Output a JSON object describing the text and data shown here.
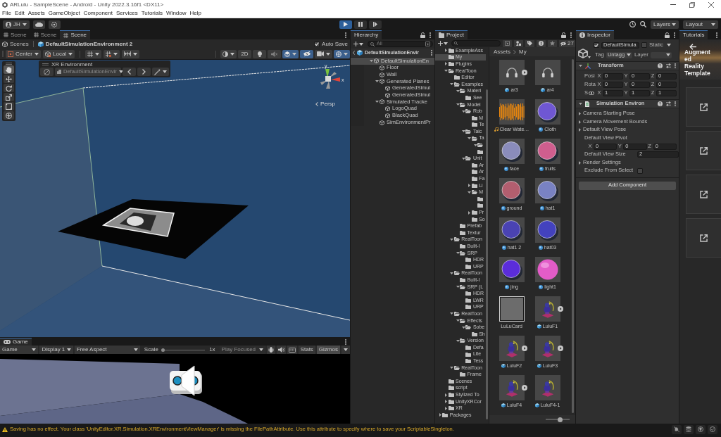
{
  "window": {
    "title": "ARLulu - SampleScene - Android - Unity 2022.3.16f1 <DX11>"
  },
  "menu": [
    "File",
    "Edit",
    "Assets",
    "GameObject",
    "Component",
    "Services",
    "Tutorials",
    "Window",
    "Help"
  ],
  "toolbar": {
    "account": "JH",
    "play_controls": [
      {
        "kind": "play",
        "on": true
      },
      {
        "kind": "pause",
        "on": false
      },
      {
        "kind": "step",
        "on": false
      }
    ],
    "layers": "Layers",
    "layout": "Layout"
  },
  "scene": {
    "tabs": [
      {
        "label": "Scene",
        "selected": false
      },
      {
        "label": "Scene",
        "selected": false
      },
      {
        "label": "Scene",
        "selected": true
      }
    ],
    "breadcrumb": {
      "root": "Scenes",
      "scene": "DefaultSimulationEnvironment 2"
    },
    "auto_save": {
      "label": "Auto Save",
      "checked": true
    },
    "pivot": "Center",
    "space": "Local",
    "mode_2d": "2D",
    "view_toggles": [
      {
        "kind": "lighting",
        "on": false
      },
      {
        "kind": "audio",
        "on": false
      },
      {
        "kind": "effects",
        "on": true
      },
      {
        "kind": "visibility",
        "on": true
      },
      {
        "kind": "camera",
        "on": false
      },
      {
        "kind": "gizmos",
        "on": true
      }
    ],
    "tools": [
      {
        "kind": "hand",
        "selected": true
      },
      {
        "kind": "move",
        "selected": false
      },
      {
        "kind": "rotate",
        "selected": false
      },
      {
        "kind": "scale",
        "selected": false
      },
      {
        "kind": "rect",
        "selected": false
      },
      {
        "kind": "transform",
        "selected": false
      }
    ],
    "xr_overlay": {
      "title": "XR Environment",
      "environment": "DefaultSimulationEnvir"
    },
    "gizmo": {
      "y_label": "y",
      "x_label": "x",
      "projection": "Persp"
    }
  },
  "game": {
    "tab": "Game",
    "view_mode": "Game",
    "display": "Display 1",
    "aspect": "Free Aspect",
    "scale": {
      "label": "Scale",
      "level": 0,
      "reading": "1x"
    },
    "play_mode": {
      "label": "Play Focused",
      "disabled": true
    },
    "stats": {
      "label": "Stats",
      "on": false
    },
    "gizmos": {
      "label": "Gizmos",
      "on": true
    }
  },
  "hierarchy": {
    "title": "Hierarchy",
    "search_placeholder": "All",
    "scene": "DefaultSimulationEnvir",
    "items": [
      {
        "label": "DefaultSimulationEn",
        "selected": true,
        "expanded": true,
        "children": [
          {
            "label": "Floor",
            "selected": false
          },
          {
            "label": "Wall",
            "selected": false
          },
          {
            "label": "Generated Planes",
            "selected": false,
            "expanded": true,
            "children": [
              {
                "label": "GeneratedSimul",
                "selected": false
              },
              {
                "label": "GeneratedSimul",
                "selected": false
              }
            ]
          },
          {
            "label": "Simulated Tracke",
            "selected": false,
            "expanded": true,
            "children": [
              {
                "label": "LogoQuad",
                "selected": false
              },
              {
                "label": "BlackQuad",
                "selected": false
              }
            ]
          },
          {
            "label": "SimEnvironmentPr",
            "selected": false
          }
        ]
      }
    ]
  },
  "project": {
    "title": "Project",
    "hidden_count": "27",
    "tree": [
      {
        "label": "ExampleAss",
        "selected": false,
        "expanded": false
      },
      {
        "label": "My",
        "selected": true
      },
      {
        "label": "Plugins",
        "selected": false,
        "expanded": false
      },
      {
        "label": "RealToon",
        "selected": false,
        "expanded": true,
        "children": [
          {
            "label": "Editor",
            "selected": false
          },
          {
            "label": "Examples",
            "selected": false,
            "expanded": true,
            "children": [
              {
                "label": "Materi",
                "selected": false,
                "expanded": true,
                "children": [
                  {
                    "label": "See",
                    "selected": false
                  }
                ]
              },
              {
                "label": "Model",
                "selected": false,
                "expanded": true,
                "children": [
                  {
                    "label": "Rob",
                    "selected": false,
                    "expanded": true,
                    "children": [
                      {
                        "label": "M",
                        "selected": false
                      },
                      {
                        "label": "Te",
                        "selected": false
                      }
                    ]
                  },
                  {
                    "label": "Taic",
                    "selected": false,
                    "expanded": true,
                    "children": [
                      {
                        "label": "Ta",
                        "selected": false,
                        "expanded": true,
                        "children": [
                          {
                            "selected": false,
                            "expanded": true
                          },
                          {
                            "selected": false
                          }
                        ]
                      }
                    ]
                  },
                  {
                    "label": "Unit",
                    "selected": false,
                    "expanded": true,
                    "children": [
                      {
                        "label": "Ar",
                        "selected": false
                      },
                      {
                        "label": "Ar",
                        "selected": false
                      },
                      {
                        "label": "Fa",
                        "selected": false
                      },
                      {
                        "label": "Li",
                        "selected": false,
                        "expanded": false
                      },
                      {
                        "label": "M",
                        "selected": false,
                        "expanded": true,
                        "children": [
                          {
                            "selected": false
                          },
                          {
                            "selected": false
                          }
                        ]
                      },
                      {
                        "label": "Pr",
                        "selected": false,
                        "expanded": false
                      },
                      {
                        "label": "So",
                        "selected": false
                      }
                    ]
                  }
                ]
              },
              {
                "label": "Prefab",
                "selected": false
              },
              {
                "label": "Textur",
                "selected": false
              }
            ]
          },
          {
            "label": "RealToon",
            "selected": false,
            "expanded": true,
            "children": [
              {
                "label": "Built-I",
                "selected": false
              },
              {
                "label": "SRP",
                "selected": false,
                "expanded": true,
                "children": [
                  {
                    "label": "HDR",
                    "selected": false
                  },
                  {
                    "label": "URP",
                    "selected": false
                  }
                ]
              }
            ]
          },
          {
            "label": "RealToon",
            "selected": false,
            "expanded": true,
            "children": [
              {
                "label": "Built-I",
                "selected": false
              },
              {
                "label": "SRP (L",
                "selected": false,
                "expanded": true,
                "children": [
                  {
                    "label": "HDR",
                    "selected": false
                  },
                  {
                    "label": "LWR",
                    "selected": false
                  },
                  {
                    "label": "URP",
                    "selected": false
                  }
                ]
              }
            ]
          },
          {
            "label": "RealToon",
            "selected": false,
            "expanded": true,
            "children": [
              {
                "label": "Effects",
                "selected": false,
                "expanded": true,
                "children": [
                  {
                    "label": "Sobe",
                    "selected": false,
                    "expanded": true,
                    "children": [
                      {
                        "label": "Sh",
                        "selected": false
                      }
                    ]
                  }
                ]
              },
              {
                "label": "Version",
                "selected": false,
                "expanded": true,
                "children": [
                  {
                    "label": "Defa",
                    "selected": false
                  },
                  {
                    "label": "Lite",
                    "selected": false
                  },
                  {
                    "label": "Tess",
                    "selected": false
                  }
                ]
              }
            ]
          },
          {
            "label": "RealToon",
            "selected": false,
            "expanded": true,
            "children": [
              {
                "label": "Frame",
                "selected": false
              }
            ]
          }
        ]
      },
      {
        "label": "Scenes",
        "selected": false
      },
      {
        "label": "script",
        "selected": false
      },
      {
        "label": "Stylized To",
        "selected": false,
        "expanded": false
      },
      {
        "label": "UnityXRCor",
        "selected": false,
        "expanded": false
      },
      {
        "label": "XR",
        "selected": false,
        "expanded": false
      }
    ],
    "packages": {
      "label": "Packages",
      "expanded": false
    },
    "path": [
      "Assets",
      "My"
    ],
    "assets": [
      {
        "name": "ar3",
        "kind": "headset",
        "expandable": true
      },
      {
        "name": "ar4",
        "kind": "headset",
        "expandable": false
      },
      {
        "name": "Clear Wate…",
        "kind": "audio",
        "expandable": false
      },
      {
        "name": "Cloth",
        "kind": "disc",
        "color": "#6f57d3",
        "expandable": false
      },
      {
        "name": "face",
        "kind": "disc",
        "color": "#8a8cbb",
        "expandable": false
      },
      {
        "name": "fruits",
        "kind": "disc",
        "color": "#cf5e8e",
        "expandable": false
      },
      {
        "name": "ground",
        "kind": "disc",
        "color": "#b25e6f",
        "expandable": false
      },
      {
        "name": "hat1",
        "kind": "disc",
        "color": "#7982c3",
        "expandable": false
      },
      {
        "name": "hat1 2",
        "kind": "disc",
        "color": "#4a43b3",
        "expandable": false
      },
      {
        "name": "hat03",
        "kind": "disc",
        "color": "#4342be",
        "expandable": false
      },
      {
        "name": "jing",
        "kind": "disc",
        "color": "#5b2ddb",
        "expandable": false
      },
      {
        "name": "light1",
        "kind": "sphere",
        "color": "#e35cc8",
        "expandable": false
      },
      {
        "name": "LuLuCard",
        "kind": "texture",
        "expandable": false
      },
      {
        "name": "LuluF1",
        "kind": "figure",
        "expandable": true
      },
      {
        "name": "LuluF2",
        "kind": "figure",
        "expandable": true
      },
      {
        "name": "LuluF3",
        "kind": "figure",
        "expandable": true
      },
      {
        "name": "LuluF4",
        "kind": "figure",
        "expandable": true
      },
      {
        "name": "LuluF4-1",
        "kind": "figure",
        "expandable": false
      }
    ],
    "icon_size": {
      "level": 0.6
    }
  },
  "inspector": {
    "title": "Inspector",
    "object": {
      "active": true,
      "name": "DefaultSimula",
      "static": false,
      "static_label": "Static",
      "tag_label": "Tag",
      "tag": "Untagg",
      "layer_label": "Layer"
    },
    "components": [
      {
        "kind": "transform",
        "title": "Transform",
        "expanded": true,
        "rows": [
          {
            "kind": "vector",
            "label": "Posi",
            "fields": [
              {
                "axis": "X",
                "value": "0"
              },
              {
                "axis": "Y",
                "value": "0"
              },
              {
                "axis": "Z",
                "value": "0"
              }
            ]
          },
          {
            "kind": "vector",
            "label": "Rota",
            "fields": [
              {
                "axis": "X",
                "value": "0"
              },
              {
                "axis": "Y",
                "value": "0"
              },
              {
                "axis": "Z",
                "value": "0"
              }
            ]
          },
          {
            "kind": "scale",
            "label": "S",
            "fields": [
              {
                "axis": "X",
                "value": "1"
              },
              {
                "axis": "Y",
                "value": "1"
              },
              {
                "axis": "Z",
                "value": "1"
              }
            ]
          }
        ]
      },
      {
        "kind": "script",
        "title": "Simulation Environ",
        "expanded": true,
        "rows": [
          {
            "kind": "foldout",
            "label": "Camera Starting Pose",
            "expanded": false
          },
          {
            "kind": "foldout",
            "label": "Camera Movement Bounds",
            "expanded": false
          },
          {
            "kind": "foldout",
            "label": "Default View Pose",
            "expanded": false
          },
          {
            "kind": "label",
            "label": "Default View Pivot"
          },
          {
            "kind": "vector",
            "fields": [
              {
                "axis": "X",
                "value": "0"
              },
              {
                "axis": "Y",
                "value": "0"
              },
              {
                "axis": "Z",
                "value": "0"
              }
            ]
          },
          {
            "kind": "number",
            "label": "Default View Size",
            "value": "2"
          },
          {
            "kind": "foldout",
            "label": "Render Settings",
            "expanded": false
          },
          {
            "kind": "checkbox",
            "label": "Exclude From Select",
            "checked": false
          }
        ]
      }
    ],
    "add_component": "Add Component"
  },
  "tutorials": {
    "title": "Tutorials",
    "banner": "Augmented Reality Template",
    "cards": [
      {
        "kind": "link"
      },
      {
        "kind": "link"
      },
      {
        "kind": "link"
      },
      {
        "kind": "link"
      }
    ]
  },
  "status": {
    "warning": true,
    "message": "Saving has no effect. Your class 'UnityEditor.XR.Simulation.XREnvironmentViewManager' is missing the FilePathAttribute. Use this attribute to specify where to save your ScriptableSingleton."
  }
}
